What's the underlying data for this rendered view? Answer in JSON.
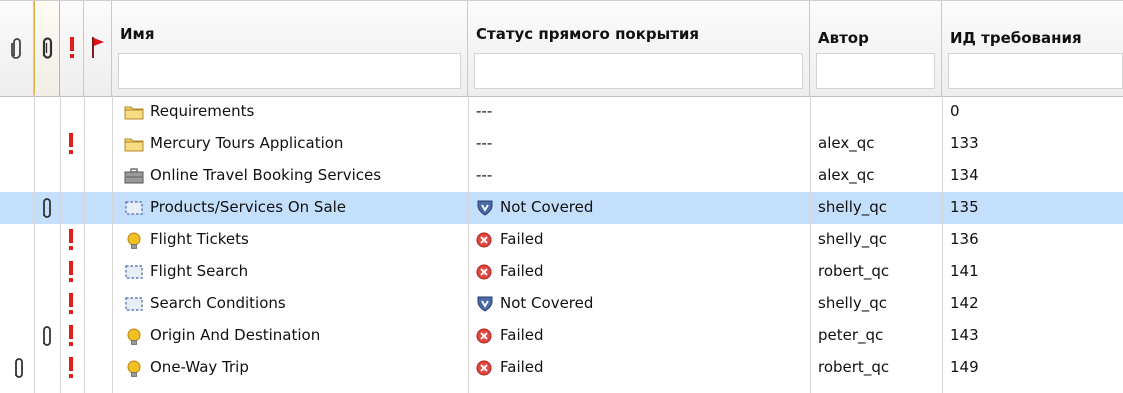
{
  "columns": {
    "name": "Имя",
    "coverage": "Статус прямого покрытия",
    "author": "Автор",
    "req_id": "ИД требования"
  },
  "rows": [
    {
      "icon": "folder-icon",
      "name": "Requirements",
      "coverage": "---",
      "coverage_icon": "",
      "author": "",
      "req_id": "0",
      "clip": false,
      "clip2": false,
      "excl": false,
      "selected": false
    },
    {
      "icon": "folder-icon",
      "name": "Mercury Tours Application",
      "coverage": "---",
      "coverage_icon": "",
      "author": "alex_qc",
      "req_id": "133",
      "clip": false,
      "clip2": false,
      "excl": true,
      "selected": false
    },
    {
      "icon": "briefcase-icon",
      "name": "Online Travel Booking Services",
      "coverage": "---",
      "coverage_icon": "",
      "author": "alex_qc",
      "req_id": "134",
      "clip": false,
      "clip2": false,
      "excl": false,
      "selected": false
    },
    {
      "icon": "dashed-box-icon",
      "name": "Products/Services On Sale",
      "coverage": "Not Covered",
      "coverage_icon": "not-covered-icon",
      "author": "shelly_qc",
      "req_id": "135",
      "clip": false,
      "clip2": true,
      "excl": false,
      "selected": true
    },
    {
      "icon": "lightbulb-icon",
      "name": "Flight Tickets",
      "coverage": "Failed",
      "coverage_icon": "failed-icon",
      "author": "shelly_qc",
      "req_id": "136",
      "clip": false,
      "clip2": false,
      "excl": true,
      "selected": false
    },
    {
      "icon": "dashed-box-icon",
      "name": "Flight Search",
      "coverage": "Failed",
      "coverage_icon": "failed-icon",
      "author": "robert_qc",
      "req_id": "141",
      "clip": false,
      "clip2": false,
      "excl": true,
      "selected": false
    },
    {
      "icon": "dashed-box-icon",
      "name": "Search Conditions",
      "coverage": "Not Covered",
      "coverage_icon": "not-covered-icon",
      "author": "shelly_qc",
      "req_id": "142",
      "clip": false,
      "clip2": false,
      "excl": true,
      "selected": false
    },
    {
      "icon": "lightbulb-icon",
      "name": "Origin And Destination",
      "coverage": "Failed",
      "coverage_icon": "failed-icon",
      "author": "peter_qc",
      "req_id": "143",
      "clip": false,
      "clip2": true,
      "excl": true,
      "selected": false
    },
    {
      "icon": "lightbulb-icon",
      "name": "One-Way Trip",
      "coverage": "Failed",
      "coverage_icon": "failed-icon",
      "author": "robert_qc",
      "req_id": "149",
      "clip": true,
      "clip2": false,
      "excl": true,
      "selected": false
    }
  ],
  "colors": {
    "selected_row": "#c4dffb",
    "exclamation": "#e31b1b",
    "flag": "#d8141a",
    "failed": "#e2453c",
    "not_covered": "#4a6aa8",
    "folder": "#f3cf68",
    "bulb": "#f0c020"
  }
}
